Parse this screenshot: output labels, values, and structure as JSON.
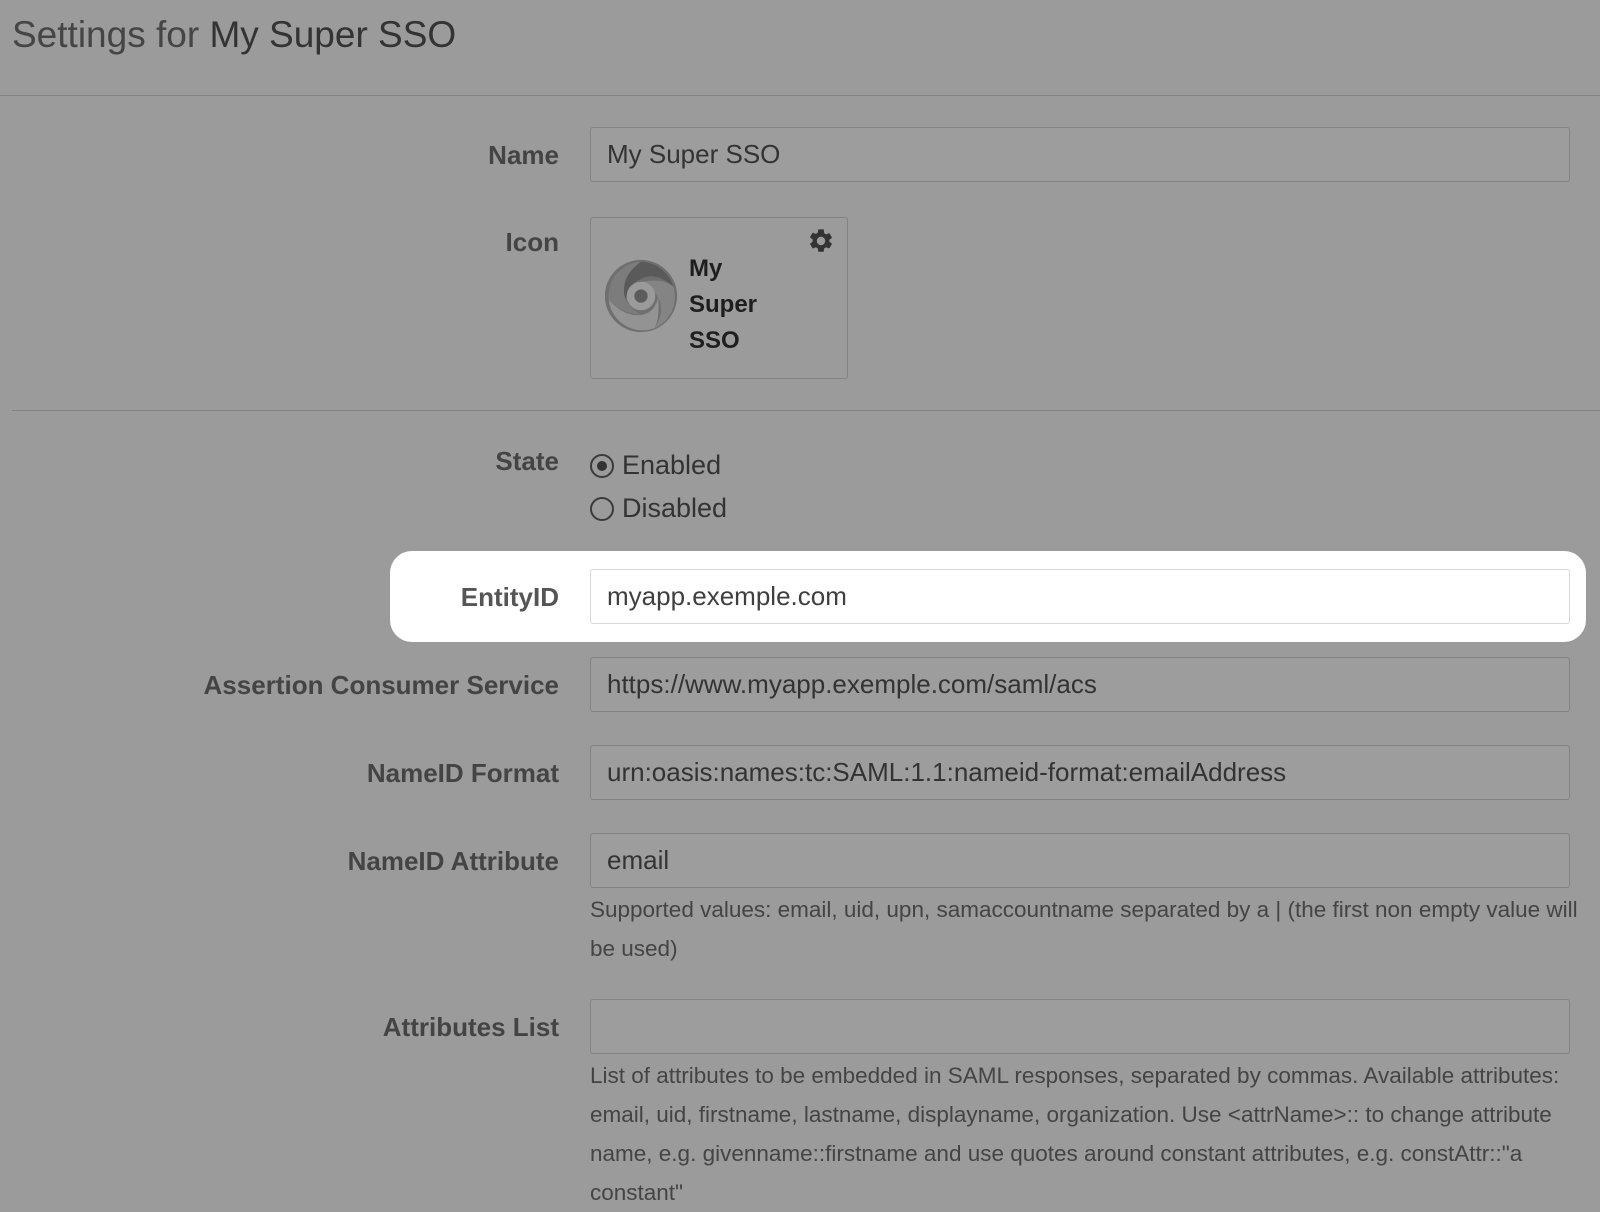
{
  "header": {
    "prefix": "Settings for",
    "app_name": "My Super SSO"
  },
  "form": {
    "name": {
      "label": "Name",
      "value": "My Super SSO"
    },
    "icon": {
      "label": "Icon",
      "card_title": "My Super SSO",
      "settings_icon": "gear-icon",
      "logo_icon": "swirl-logo-icon"
    },
    "state": {
      "label": "State",
      "options": [
        {
          "label": "Enabled",
          "checked": true
        },
        {
          "label": "Disabled",
          "checked": false
        }
      ]
    },
    "entity_id": {
      "label": "EntityID",
      "value": "myapp.exemple.com"
    },
    "acs": {
      "label": "Assertion Consumer Service",
      "value": "https://www.myapp.exemple.com/saml/acs"
    },
    "nameid_format": {
      "label": "NameID Format",
      "value": "urn:oasis:names:tc:SAML:1.1:nameid-format:emailAddress"
    },
    "nameid_attribute": {
      "label": "NameID Attribute",
      "value": "email",
      "help": "Supported values: email, uid, upn, samaccountname separated by a | (the first non empty value will be used)"
    },
    "attributes_list": {
      "label": "Attributes List",
      "value": "",
      "help": "List of attributes to be embedded in SAML responses, separated by commas. Available attributes: email, uid, firstname, lastname, displayname, organization. Use <attrName>:: to change attribute name, e.g. givenname::firstname and use quotes around constant attributes, e.g. constAttr::\"a constant\""
    }
  },
  "colors": {
    "overlay_background": "#9b9b9b",
    "highlight": "#ffffff"
  }
}
